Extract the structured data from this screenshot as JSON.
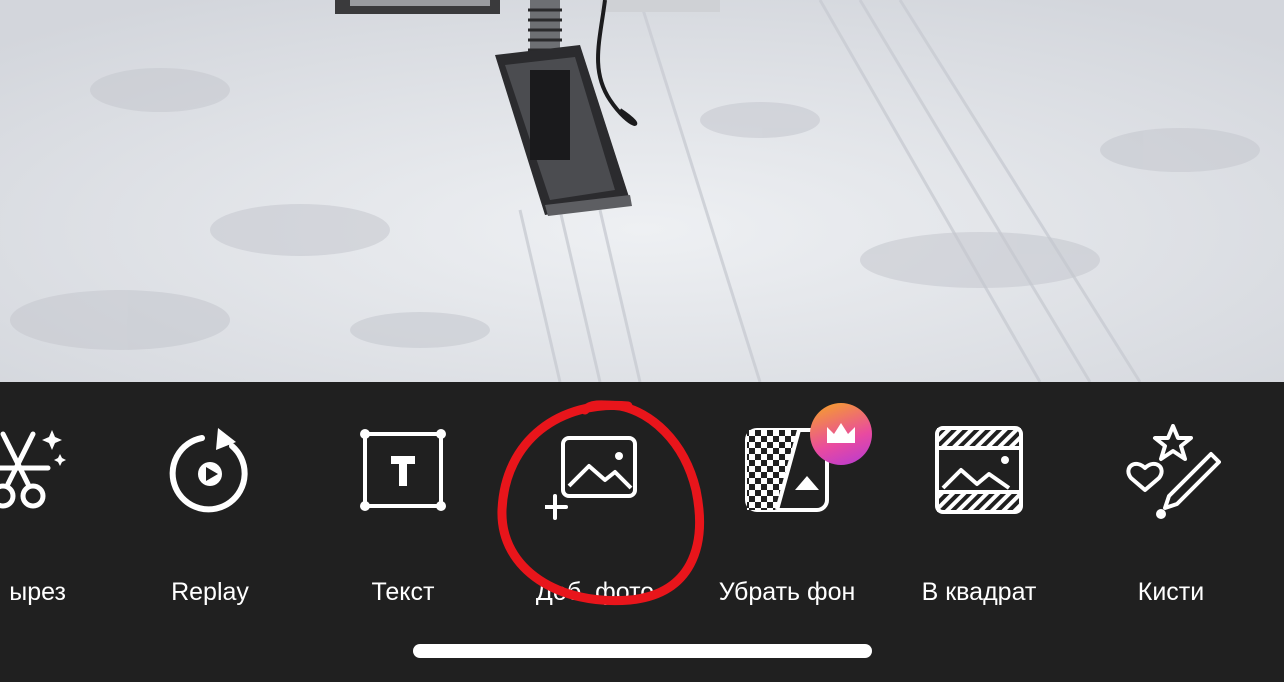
{
  "photo": {
    "subject": "snow-scooter-ski-in-snow"
  },
  "toolbar": {
    "items": [
      {
        "id": "cutout",
        "label": "ырез",
        "icon": "scissors-sparkle-icon"
      },
      {
        "id": "replay",
        "label": "Replay",
        "icon": "replay-play-icon"
      },
      {
        "id": "text",
        "label": "Текст",
        "icon": "text-box-icon"
      },
      {
        "id": "add-photo",
        "label": "Доб. фото",
        "icon": "add-photo-icon"
      },
      {
        "id": "remove-bg",
        "label": "Убрать фон",
        "icon": "remove-background-icon",
        "premium": true
      },
      {
        "id": "square",
        "label": "В квадрат",
        "icon": "square-fit-icon"
      },
      {
        "id": "brushes",
        "label": "Кисти",
        "icon": "brush-star-icon"
      }
    ]
  },
  "colors": {
    "toolbar_bg": "#202020",
    "annotation": "#e8151b",
    "premium_badge": "#e94aa0"
  }
}
